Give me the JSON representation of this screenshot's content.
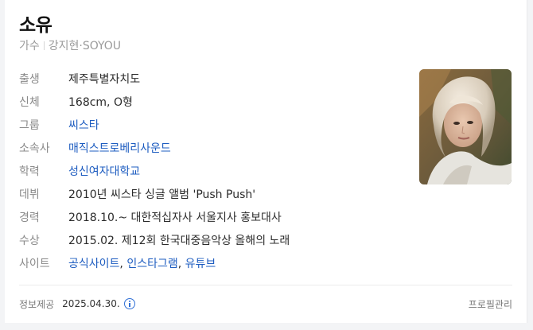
{
  "profile": {
    "name": "소유",
    "occupation": "가수",
    "real_name": "강지현",
    "romanized": "SOYOU"
  },
  "info": [
    {
      "label": "출생",
      "value": "제주특별자치도",
      "link": false
    },
    {
      "label": "신체",
      "value": "168cm, O형",
      "link": false
    },
    {
      "label": "그룹",
      "value": "씨스타",
      "link": true
    },
    {
      "label": "소속사",
      "value": "매직스트로베리사운드",
      "link": true
    },
    {
      "label": "학력",
      "value": "성신여자대학교",
      "link": true
    },
    {
      "label": "데뷔",
      "value": "2010년 씨스타 싱글 앨범 'Push Push'",
      "link": false
    },
    {
      "label": "경력",
      "value": "2018.10.~ 대한적십자사 서울지사 홍보대사",
      "link": false
    },
    {
      "label": "수상",
      "value": "2015.02. 제12회 한국대중음악상 올해의 노래",
      "link": false
    },
    {
      "label": "사이트",
      "links": [
        "공식사이트",
        "인스타그램",
        "유튜브"
      ],
      "separator": ", "
    }
  ],
  "footer": {
    "source_label": "정보제공",
    "date": "2025.04.30.",
    "manage_label": "프로필관리"
  },
  "colors": {
    "link": "#1d5cc0",
    "label": "#8a8a8a",
    "info_icon": "#2f6fd6"
  },
  "icons": {
    "info": "info-circle-icon"
  }
}
